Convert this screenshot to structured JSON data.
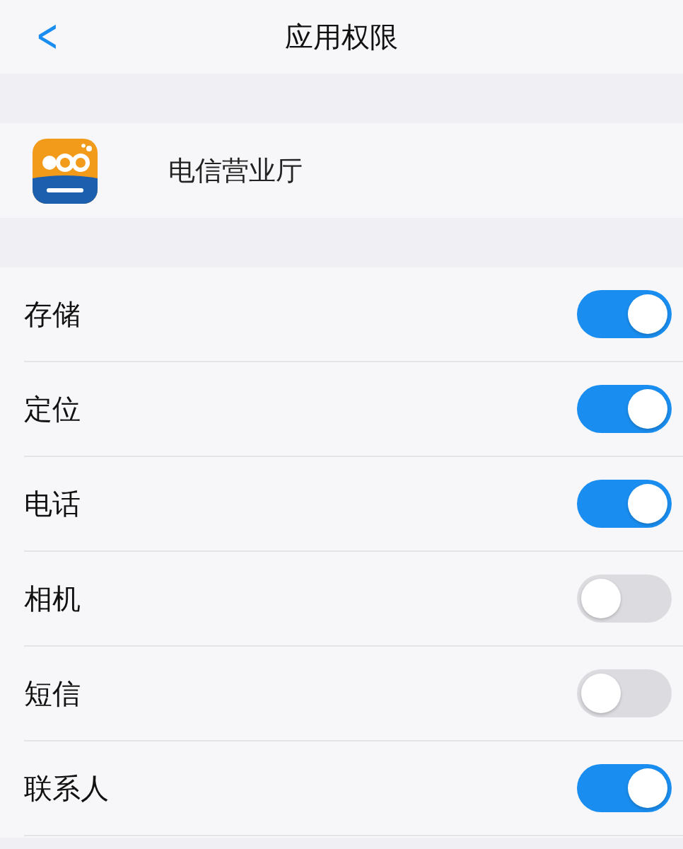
{
  "header": {
    "back": "<",
    "title": "应用权限"
  },
  "app": {
    "name": "电信营业厅"
  },
  "permissions": [
    {
      "label": "存储",
      "on": true
    },
    {
      "label": "定位",
      "on": true
    },
    {
      "label": "电话",
      "on": true
    },
    {
      "label": "相机",
      "on": false
    },
    {
      "label": "短信",
      "on": false
    },
    {
      "label": "联系人",
      "on": true
    }
  ]
}
